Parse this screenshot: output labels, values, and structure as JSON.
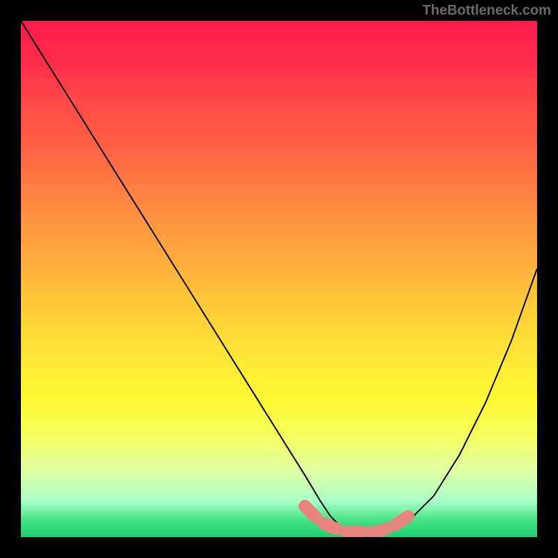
{
  "watermark": "TheBottleneck.com",
  "chart_data": {
    "type": "line",
    "title": "",
    "xlabel": "",
    "ylabel": "",
    "xlim": [
      0,
      100
    ],
    "ylim": [
      0,
      100
    ],
    "series": [
      {
        "name": "bottleneck-curve",
        "x": [
          0,
          5,
          10,
          15,
          20,
          25,
          30,
          35,
          40,
          45,
          50,
          55,
          58,
          60,
          62,
          65,
          68,
          70,
          73,
          76,
          80,
          85,
          90,
          95,
          100
        ],
        "values": [
          100,
          92,
          84,
          76,
          68,
          60,
          52,
          44,
          36,
          28,
          20,
          12,
          7,
          4,
          2,
          1,
          1,
          1,
          2,
          4,
          8,
          16,
          26,
          38,
          52
        ]
      }
    ],
    "markers": {
      "name": "highlight-band",
      "color": "#e8857c",
      "x": [
        55,
        58,
        60,
        63,
        66,
        69,
        72,
        75
      ],
      "values": [
        6,
        3,
        2,
        1,
        1,
        1,
        2,
        4
      ]
    },
    "gradient_stops": [
      {
        "pos": 0,
        "color": "#ff1a4d"
      },
      {
        "pos": 50,
        "color": "#ffc23a"
      },
      {
        "pos": 80,
        "color": "#f5ff5a"
      },
      {
        "pos": 100,
        "color": "#1fd070"
      }
    ]
  }
}
